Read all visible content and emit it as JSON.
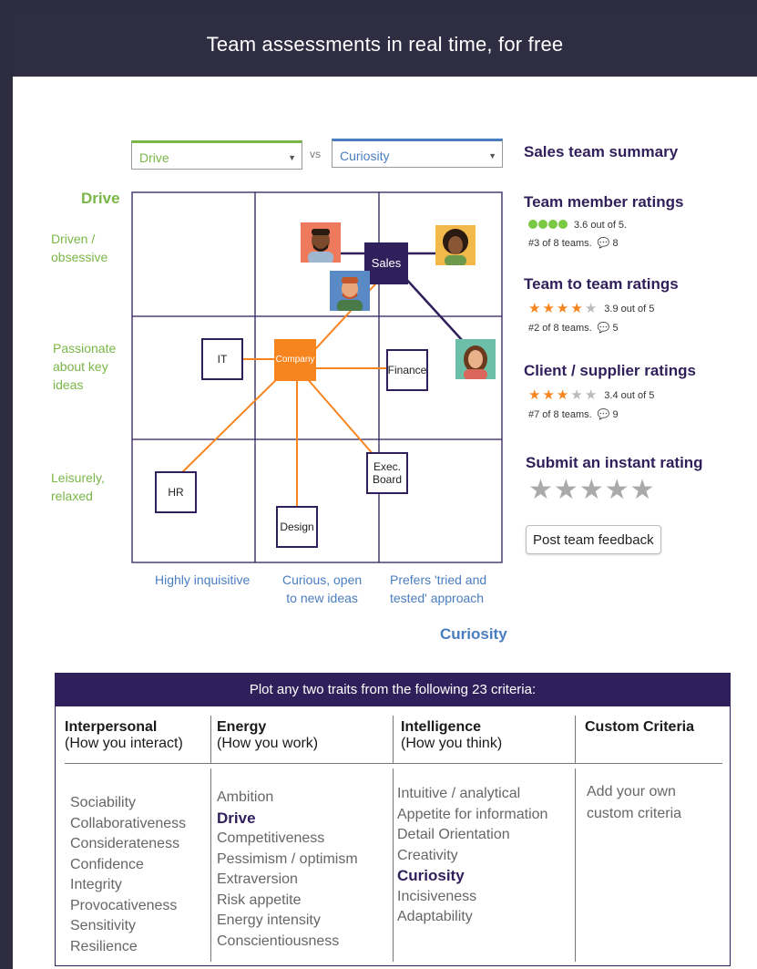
{
  "banner": {
    "title": "Team assessments in real time, for free"
  },
  "controls": {
    "select_y": "Drive",
    "vs": "vs",
    "select_x": "Curiosity"
  },
  "chart": {
    "y_axis_title": "Drive",
    "x_axis_title": "Curiosity",
    "y_levels": [
      "Driven /\nobsessive",
      "Passionate\nabout key\nideas",
      "Leisurely,\nrelaxed"
    ],
    "x_levels": [
      "Highly inquisitive",
      "Curious, open\nto new ideas",
      "Prefers 'tried and\ntested' approach"
    ],
    "nodes": {
      "sales": "Sales",
      "company": "Company",
      "it": "IT",
      "finance": "Finance",
      "hr": "HR",
      "exec_board": "Exec.\nBoard",
      "design": "Design"
    }
  },
  "summary": {
    "title": "Sales team summary",
    "member": {
      "heading": "Team member ratings",
      "rating": 3.6,
      "rating_text": "3.6 out of 5.",
      "rank_text": "#3 of 8 teams.",
      "comments": "8"
    },
    "team": {
      "heading": "Team to team ratings",
      "rating": 3.9,
      "rating_text": "3.9 out of 5",
      "rank_text": "#2 of 8 teams.",
      "comments": "5"
    },
    "client": {
      "heading": "Client / supplier ratings",
      "rating": 3.4,
      "rating_text": "3.4 out of 5",
      "rank_text": "#7 of 8 teams.",
      "comments": "9"
    },
    "submit_heading": "Submit an instant rating",
    "feedback_button": "Post team feedback"
  },
  "criteria": {
    "header": "Plot any two traits from the following 23 criteria:",
    "columns": [
      {
        "title": "Interpersonal",
        "subtitle": "(How you interact)",
        "items": [
          "Sociability",
          "Collaborativeness",
          "Considerateness",
          "Confidence",
          "Integrity",
          "Provocativeness",
          "Sensitivity",
          "Resilience"
        ]
      },
      {
        "title": "Energy",
        "subtitle": "(How you work)",
        "items": [
          "Ambition",
          "Drive",
          "Competitiveness",
          "Pessimism / optimism",
          "Extraversion",
          "Risk appetite",
          "Energy intensity",
          "Conscientiousness"
        ]
      },
      {
        "title": "Intelligence",
        "subtitle": "(How you think)",
        "items": [
          "Intuitive / analytical",
          "Appetite for information",
          "Detail Orientation",
          "Creativity",
          "Curiosity",
          "Incisiveness",
          "Adaptability"
        ]
      },
      {
        "title": "Custom Criteria",
        "subtitle": "",
        "items": [
          "Add your own\ncustom criteria"
        ]
      }
    ]
  },
  "colors": {
    "accent_purple": "#2f1f5a",
    "accent_orange": "#f7851f",
    "green": "#7ab648",
    "blue": "#4a7dc0"
  }
}
